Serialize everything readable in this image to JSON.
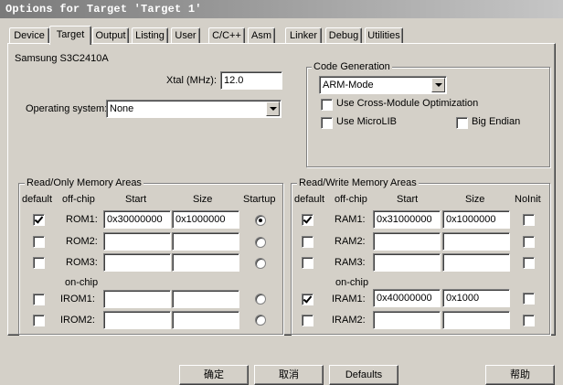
{
  "window": {
    "title": "Options for Target 'Target 1'"
  },
  "tabs": [
    {
      "label": "Device",
      "key": "D"
    },
    {
      "label": "Target",
      "key": ""
    },
    {
      "label": "Output",
      "key": "O"
    },
    {
      "label": "Listing",
      "key": "L"
    },
    {
      "label": "User",
      "key": "U"
    },
    {
      "label": "C/C++",
      "key": "C"
    },
    {
      "label": "Asm",
      "key": "A"
    },
    {
      "label": "Linker",
      "key": "L"
    },
    {
      "label": "Debug",
      "key": "D"
    },
    {
      "label": "Utilities",
      "key": "U"
    }
  ],
  "device_name": "Samsung S3C2410A",
  "xtal": {
    "label": "Xtal (MHz):",
    "value": "12.0"
  },
  "os": {
    "label": "Operating system:",
    "value": "None"
  },
  "codegen": {
    "legend": "Code Generation",
    "mode": "ARM-Mode",
    "cross_module": "Use Cross-Module Optimization",
    "microlib": "Use MicroLIB",
    "big_endian": "Big Endian"
  },
  "rom": {
    "legend": "Read/Only Memory Areas",
    "headers": {
      "default": "default",
      "offchip": "off-chip",
      "start": "Start",
      "size": "Size",
      "startup": "Startup"
    },
    "onchip_label": "on-chip",
    "rows": [
      {
        "name": "ROM1:",
        "start": "0x30000000",
        "size": "0x1000000",
        "default": true,
        "startup": true
      },
      {
        "name": "ROM2:",
        "start": "",
        "size": "",
        "default": false,
        "startup": false
      },
      {
        "name": "ROM3:",
        "start": "",
        "size": "",
        "default": false,
        "startup": false
      },
      {
        "name": "IROM1:",
        "start": "",
        "size": "",
        "default": false,
        "startup": false
      },
      {
        "name": "IROM2:",
        "start": "",
        "size": "",
        "default": false,
        "startup": false
      }
    ]
  },
  "ram": {
    "legend": "Read/Write Memory Areas",
    "headers": {
      "default": "default",
      "offchip": "off-chip",
      "start": "Start",
      "size": "Size",
      "noinit": "NoInit"
    },
    "onchip_label": "on-chip",
    "rows": [
      {
        "name": "RAM1:",
        "start": "0x31000000",
        "size": "0x1000000",
        "default": true,
        "noinit": false
      },
      {
        "name": "RAM2:",
        "start": "",
        "size": "",
        "default": false,
        "noinit": false
      },
      {
        "name": "RAM3:",
        "start": "",
        "size": "",
        "default": false,
        "noinit": false
      },
      {
        "name": "IRAM1:",
        "start": "0x40000000",
        "size": "0x1000",
        "default": true,
        "noinit": false
      },
      {
        "name": "IRAM2:",
        "start": "",
        "size": "",
        "default": false,
        "noinit": false
      }
    ]
  },
  "buttons": {
    "ok": "确定",
    "cancel": "取消",
    "defaults": "Defaults",
    "help": "帮助"
  }
}
